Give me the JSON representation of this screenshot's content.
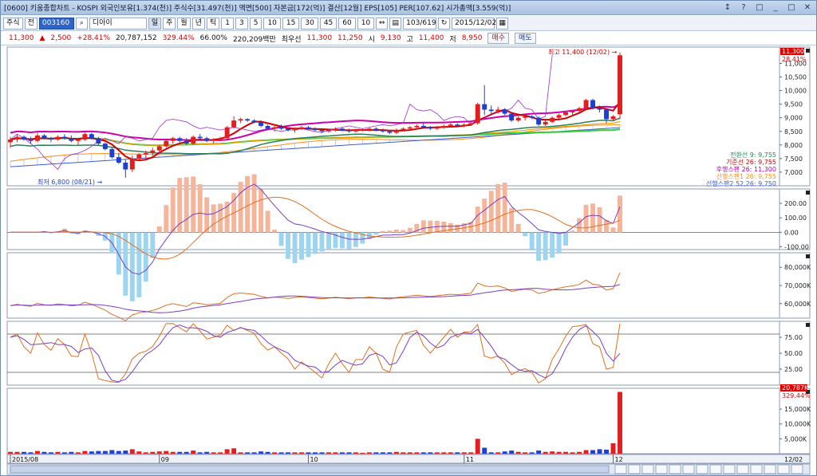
{
  "window": {
    "title": "[0600] 키움종합차트 - KOSPI 외국인보유[1.374(천)] 주식수[31.497(천)] 액면[500] 자본금[172(억)] 결산[12월] EPS[105] PER[107.62] 시가총액[3.559(억)]",
    "buttons": [
      "↕",
      "?",
      "□",
      "_",
      "□",
      "✕"
    ]
  },
  "toolbar": {
    "type_label": "주식",
    "all_label": "전",
    "code": "003160",
    "name": "디아이",
    "periods": [
      "일",
      "주",
      "월",
      "년",
      "틱"
    ],
    "minutes": [
      "1",
      "3",
      "5",
      "10",
      "15",
      "30",
      "45",
      "60",
      "10"
    ],
    "count": "103/619",
    "date": "2015/12/02"
  },
  "quote": {
    "price": "11,300",
    "arrow": "▲",
    "change": "2,500",
    "change_pct": "+28.41%",
    "volume": "20,787,152",
    "vol_ratio": "329.44%",
    "turnover": "66.00%",
    "amount": "220,209백만",
    "best_ask_label": "최우선",
    "best_ask": "11,300",
    "best_bid": "11,250",
    "open_label": "시",
    "open": "9,130",
    "high_label": "고",
    "high": "11,400",
    "low_label": "저",
    "low": "8,950",
    "buy_label": "매수",
    "sell_label": "매도"
  },
  "chart_labels": {
    "price_badge": "11,300",
    "price_badge_pct": "28.41%",
    "vol_badge": "20,787K",
    "vol_badge_pct": "329.44%",
    "high_annotation": "최고 11,400 (12/02) →",
    "low_annotation": "최저 6,800 (08/21) →",
    "ichimoku_legend": [
      {
        "text": "전환선 9: 9,755",
        "color": "#1a8c5a"
      },
      {
        "text": "기준선 26: 9,755",
        "color": "#d00000"
      },
      {
        "text": "후행스팬 26: 11,300",
        "color": "#c000c0"
      },
      {
        "text": "선행스팬1 26: 9,755",
        "color": "#ff8c1a"
      },
      {
        "text": "선행스팬2 52,26: 9,750",
        "color": "#3a5fcd"
      }
    ],
    "date_labels": [
      "2015/08",
      "09",
      "10",
      "11",
      "12"
    ],
    "date_corner": "12/02"
  },
  "chart_data": [
    {
      "type": "candlestick",
      "title": "",
      "ylim": [
        6500,
        11600
      ],
      "yticks": [
        "11,000",
        "10,500",
        "10,000",
        "9,500",
        "9,000",
        "8,500",
        "8,000",
        "7,500",
        "7,000"
      ],
      "ytick_values": [
        11000,
        10500,
        10000,
        9500,
        9000,
        8500,
        8000,
        7500,
        7000
      ],
      "ohlc": [
        [
          8100,
          8300,
          7900,
          8200
        ],
        [
          8200,
          8400,
          8100,
          8300
        ],
        [
          8300,
          8350,
          8150,
          8200
        ],
        [
          8200,
          8300,
          8050,
          8150
        ],
        [
          8150,
          8450,
          8100,
          8350
        ],
        [
          8350,
          8400,
          8200,
          8250
        ],
        [
          8250,
          8300,
          8100,
          8200
        ],
        [
          8200,
          8350,
          8150,
          8300
        ],
        [
          8300,
          8400,
          8200,
          8250
        ],
        [
          8250,
          8350,
          8100,
          8150
        ],
        [
          8150,
          8250,
          8000,
          8200
        ],
        [
          8200,
          8500,
          8150,
          8400
        ],
        [
          8400,
          8450,
          8200,
          8250
        ],
        [
          8250,
          8300,
          8000,
          8050
        ],
        [
          8050,
          8100,
          7800,
          7850
        ],
        [
          7850,
          7900,
          7500,
          7550
        ],
        [
          7550,
          7700,
          7300,
          7350
        ],
        [
          7350,
          7450,
          6800,
          7100
        ],
        [
          7100,
          7600,
          7000,
          7500
        ],
        [
          7500,
          7700,
          7400,
          7650
        ],
        [
          7650,
          7800,
          7500,
          7700
        ],
        [
          7700,
          7900,
          7600,
          7800
        ],
        [
          7800,
          8000,
          7700,
          7950
        ],
        [
          7950,
          8200,
          7900,
          8150
        ],
        [
          8150,
          8300,
          8050,
          8250
        ],
        [
          8250,
          8300,
          8100,
          8150
        ],
        [
          8150,
          8250,
          8000,
          8050
        ],
        [
          8050,
          8350,
          8000,
          8300
        ],
        [
          8300,
          8400,
          8200,
          8250
        ],
        [
          8250,
          8300,
          8100,
          8150
        ],
        [
          8150,
          8250,
          8050,
          8200
        ],
        [
          8200,
          8300,
          8150,
          8250
        ],
        [
          8250,
          8700,
          8200,
          8650
        ],
        [
          8650,
          9050,
          8600,
          8900
        ],
        [
          8900,
          9000,
          8800,
          8950
        ],
        [
          8950,
          8980,
          8850,
          8900
        ],
        [
          8900,
          8950,
          8800,
          8850
        ],
        [
          8850,
          8900,
          8650,
          8700
        ],
        [
          8700,
          8750,
          8550,
          8600
        ],
        [
          8600,
          8700,
          8500,
          8650
        ],
        [
          8650,
          8750,
          8550,
          8600
        ],
        [
          8600,
          8650,
          8500,
          8550
        ],
        [
          8550,
          8650,
          8450,
          8600
        ],
        [
          8600,
          8700,
          8550,
          8650
        ],
        [
          8650,
          8700,
          8550,
          8600
        ],
        [
          8600,
          8650,
          8500,
          8550
        ],
        [
          8550,
          8600,
          8450,
          8500
        ],
        [
          8500,
          8600,
          8450,
          8550
        ],
        [
          8550,
          8650,
          8500,
          8600
        ],
        [
          8600,
          8650,
          8500,
          8550
        ],
        [
          8550,
          8600,
          8450,
          8500
        ],
        [
          8500,
          8600,
          8450,
          8550
        ],
        [
          8550,
          8600,
          8500,
          8550
        ],
        [
          8550,
          8650,
          8500,
          8600
        ],
        [
          8600,
          8650,
          8500,
          8550
        ],
        [
          8550,
          8600,
          8450,
          8500
        ],
        [
          8500,
          8550,
          8400,
          8450
        ],
        [
          8450,
          8600,
          8400,
          8550
        ],
        [
          8550,
          8650,
          8500,
          8600
        ],
        [
          8600,
          8700,
          8550,
          8650
        ],
        [
          8650,
          8750,
          8600,
          8700
        ],
        [
          8700,
          8800,
          8600,
          8650
        ],
        [
          8650,
          8700,
          8550,
          8600
        ],
        [
          8600,
          8700,
          8550,
          8650
        ],
        [
          8650,
          8750,
          8600,
          8700
        ],
        [
          8700,
          8800,
          8650,
          8750
        ],
        [
          8750,
          8800,
          8650,
          8700
        ],
        [
          8700,
          8800,
          8650,
          8750
        ],
        [
          8750,
          8850,
          8700,
          8800
        ],
        [
          8800,
          9550,
          8750,
          9500
        ],
        [
          9500,
          10200,
          9100,
          9300
        ],
        [
          9300,
          9450,
          9150,
          9250
        ],
        [
          9250,
          9400,
          9150,
          9300
        ],
        [
          9300,
          9350,
          9100,
          9150
        ],
        [
          9150,
          9200,
          8850,
          8900
        ],
        [
          8900,
          9050,
          8850,
          9000
        ],
        [
          9000,
          9100,
          8900,
          9050
        ],
        [
          9050,
          9100,
          8950,
          9000
        ],
        [
          9000,
          9050,
          8700,
          8750
        ],
        [
          8750,
          8900,
          8700,
          8850
        ],
        [
          8850,
          9050,
          8800,
          9000
        ],
        [
          9000,
          9150,
          8950,
          9100
        ],
        [
          9100,
          9250,
          9050,
          9200
        ],
        [
          9200,
          9300,
          9100,
          9250
        ],
        [
          9250,
          9400,
          9200,
          9350
        ],
        [
          9350,
          9700,
          9300,
          9650
        ],
        [
          9650,
          9700,
          9300,
          9350
        ],
        [
          9350,
          9450,
          9200,
          9300
        ],
        [
          9300,
          9350,
          8800,
          8950
        ],
        [
          8950,
          9100,
          8900,
          9050
        ],
        [
          9130,
          11400,
          8950,
          11300
        ]
      ]
    },
    {
      "type": "line",
      "title": "",
      "ylim": [
        -120,
        300
      ],
      "yticks": [
        "200.00",
        "100.00",
        "0.00",
        "-100.00"
      ],
      "ytick_values": [
        200,
        100,
        0,
        -100
      ]
    },
    {
      "type": "line",
      "title": "",
      "ylim": [
        52000,
        88000
      ],
      "yticks": [
        "80,000K",
        "70,000K",
        "60,000K"
      ],
      "ytick_values": [
        80000,
        70000,
        60000
      ]
    },
    {
      "type": "line",
      "title": "",
      "ylim": [
        0,
        100
      ],
      "yticks": [
        "75.00",
        "50.00",
        "25.00"
      ],
      "ytick_values": [
        75,
        50,
        25
      ]
    },
    {
      "type": "bar",
      "title": "",
      "ylim": [
        0,
        22000
      ],
      "yticks": [
        "15,000K",
        "10,000K",
        "5,000K"
      ],
      "ytick_values": [
        15000,
        10000,
        5000
      ]
    }
  ]
}
